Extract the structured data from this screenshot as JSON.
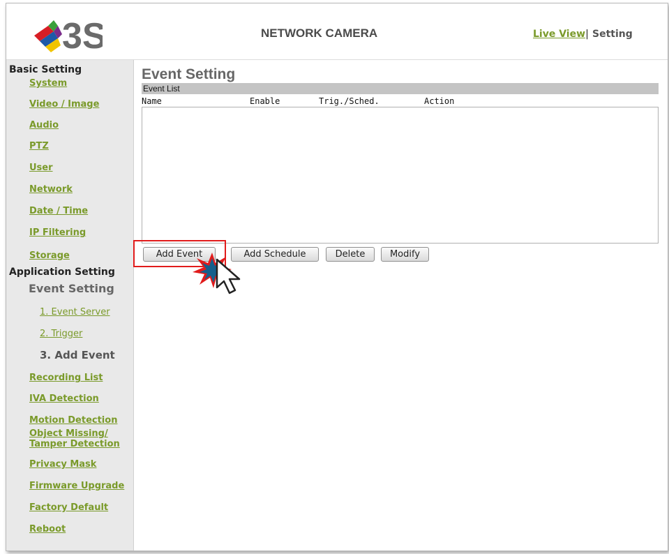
{
  "header": {
    "logo_text": "3S",
    "title": "NETWORK CAMERA",
    "live_view": "Live View",
    "separator": "|",
    "setting": "Setting"
  },
  "sidebar": {
    "basic_heading": "Basic Setting",
    "basic_items": [
      "System",
      "Video / Image",
      "Audio",
      "PTZ",
      "User",
      "Network",
      "Date / Time",
      "IP Filtering",
      "Storage"
    ],
    "app_heading": "Application Setting",
    "event_setting": "Event Setting",
    "event_subitems": [
      "1. Event Server",
      "2. Trigger"
    ],
    "event_current": "3. Add Event",
    "app_items": [
      "Recording List",
      "IVA Detection",
      "Motion Detection"
    ],
    "object_missing_line1": "Object Missing/",
    "object_missing_line2": "Tamper Detection",
    "app_items2": [
      "Privacy Mask",
      "Firmware Upgrade",
      "Factory Default",
      "Reboot"
    ]
  },
  "main": {
    "title": "Event Setting",
    "list_label": "Event List",
    "columns": [
      "Name",
      "Enable",
      "Trig./Sched.",
      "Action"
    ],
    "buttons": {
      "add_event": "Add Event",
      "add_schedule": "Add Schedule",
      "delete": "Delete",
      "modify": "Modify"
    }
  },
  "colors": {
    "link_green": "#7a9a2a",
    "highlight_red": "#e11b1b",
    "sidebar_bg": "#e9e9e9"
  },
  "icons": [
    "logo-icon",
    "click-burst-icon",
    "cursor-arrow-icon"
  ]
}
